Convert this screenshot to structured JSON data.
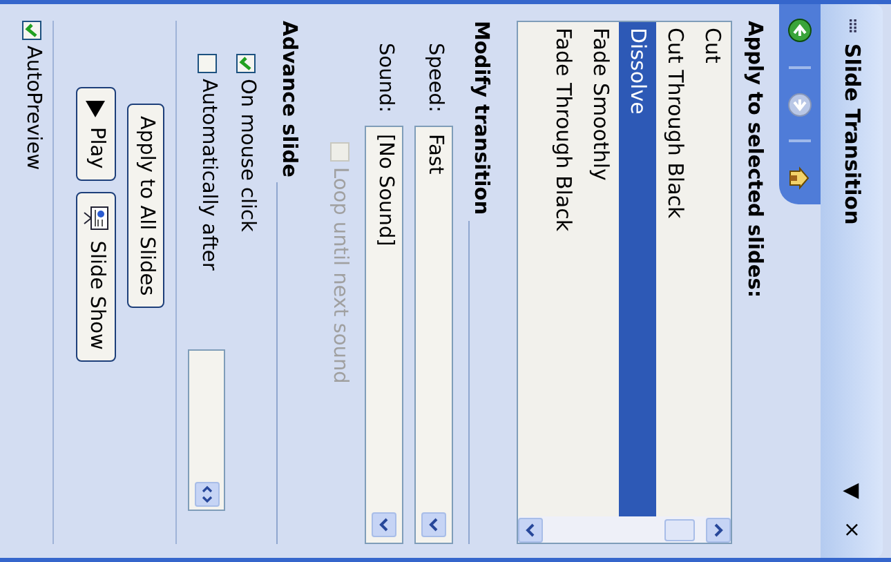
{
  "task_pane": {
    "grip": "::::",
    "title": "Slide Transition",
    "menu_glyph": "▼",
    "close_glyph": "×"
  },
  "nav_buttons": [
    {
      "kind": "back",
      "enabled": true
    },
    {
      "kind": "forward",
      "enabled": false
    },
    {
      "kind": "home"
    }
  ],
  "apply_section": {
    "heading": "Apply to selected slides:",
    "transitions": [
      {
        "label": "Cut",
        "selected": false
      },
      {
        "label": "Cut Through Black",
        "selected": false
      },
      {
        "label": "Dissolve",
        "selected": true
      },
      {
        "label": "Fade Smoothly",
        "selected": false
      },
      {
        "label": "Fade Through Black",
        "selected": false
      }
    ]
  },
  "modify_section": {
    "heading": "Modify transition",
    "speed": {
      "label": "Speed:",
      "value": "Fast"
    },
    "sound": {
      "label": "Sound:",
      "value": "[No Sound]"
    },
    "loop": {
      "label": "Loop until next sound",
      "checked": false,
      "disabled": true
    }
  },
  "advance_section": {
    "heading": "Advance slide",
    "on_mouse_click": {
      "label": "On mouse click",
      "checked": true
    },
    "automatically_after": {
      "label": "Automatically after",
      "checked": false
    }
  },
  "buttons": [
    {
      "kind": "apply",
      "label": "Apply to All Slides"
    },
    {
      "kind": "play",
      "label": "Play"
    },
    {
      "kind": "slideshow",
      "label": "Slide Show"
    }
  ],
  "autopreview": {
    "label": "AutoPreview",
    "checked": true
  }
}
